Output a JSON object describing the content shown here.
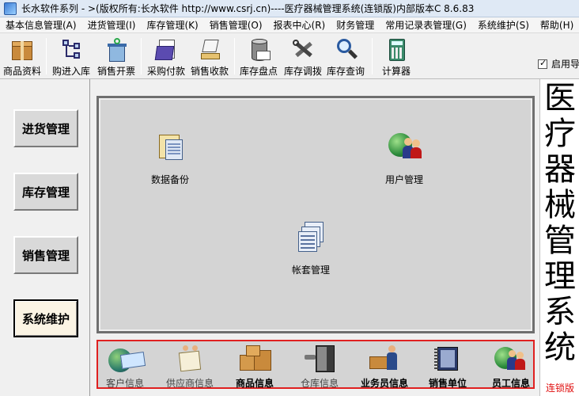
{
  "window": {
    "title": "长水软件系列 - >(版权所有:长水软件 http://www.csrj.cn)----医疗器械管理系统(连锁版)内部版本C 8.6.83"
  },
  "menu": [
    "基本信息管理(A)",
    "进货管理(I)",
    "库存管理(K)",
    "销售管理(O)",
    "报表中心(R)",
    "财务管理",
    "常用记录表管理(G)",
    "系统维护(S)",
    "帮助(H)"
  ],
  "toolbar": {
    "buttons": [
      {
        "label": "商品资料",
        "icon": "boxes-icon"
      },
      {
        "label": "购进入库",
        "icon": "flowchart-icon"
      },
      {
        "label": "销售开票",
        "icon": "recycle-bin-icon"
      },
      {
        "label": "采购付款",
        "icon": "folder-doc-icon"
      },
      {
        "label": "销售收款",
        "icon": "laptop-icon"
      },
      {
        "label": "库存盘点",
        "icon": "database-icon"
      },
      {
        "label": "库存调拨",
        "icon": "tools-icon"
      },
      {
        "label": "库存查询",
        "icon": "magnifier-icon"
      },
      {
        "label": "计算器",
        "icon": "calculator-icon"
      }
    ],
    "checkbox_label": "启用导",
    "checkbox_checked": true
  },
  "nav": {
    "items": [
      {
        "label": "进货管理"
      },
      {
        "label": "库存管理"
      },
      {
        "label": "销售管理"
      },
      {
        "label": "系统维护",
        "active": true
      }
    ]
  },
  "main": {
    "items": [
      {
        "label": "数据备份",
        "icon": "folder-backup-icon"
      },
      {
        "label": "用户管理",
        "icon": "users-globe-icon"
      },
      {
        "label": "帐套管理",
        "icon": "ledger-stack-icon"
      }
    ]
  },
  "bottom": {
    "items": [
      {
        "label": "客户信息",
        "icon": "region-globe-icon",
        "bold": false
      },
      {
        "label": "供应商信息",
        "icon": "handshake-icon",
        "bold": false
      },
      {
        "label": "商品信息",
        "icon": "cardboard-boxes-icon",
        "bold": true
      },
      {
        "label": "仓库信息",
        "icon": "warehouse-door-icon",
        "bold": false
      },
      {
        "label": "业务员信息",
        "icon": "salesman-icon",
        "bold": true
      },
      {
        "label": "销售单位",
        "icon": "sales-book-icon",
        "bold": true
      },
      {
        "label": "员工信息",
        "icon": "staff-globe-icon",
        "bold": true
      }
    ]
  },
  "banner": {
    "chars": [
      "医",
      "疗",
      "器",
      "械",
      "管",
      "理",
      "系",
      "统"
    ],
    "subtitle": "连锁版"
  },
  "colors": {
    "accent_red": "#e02020",
    "panel_gray": "#d4d4d4",
    "banner_sub_red": "#e01010"
  }
}
